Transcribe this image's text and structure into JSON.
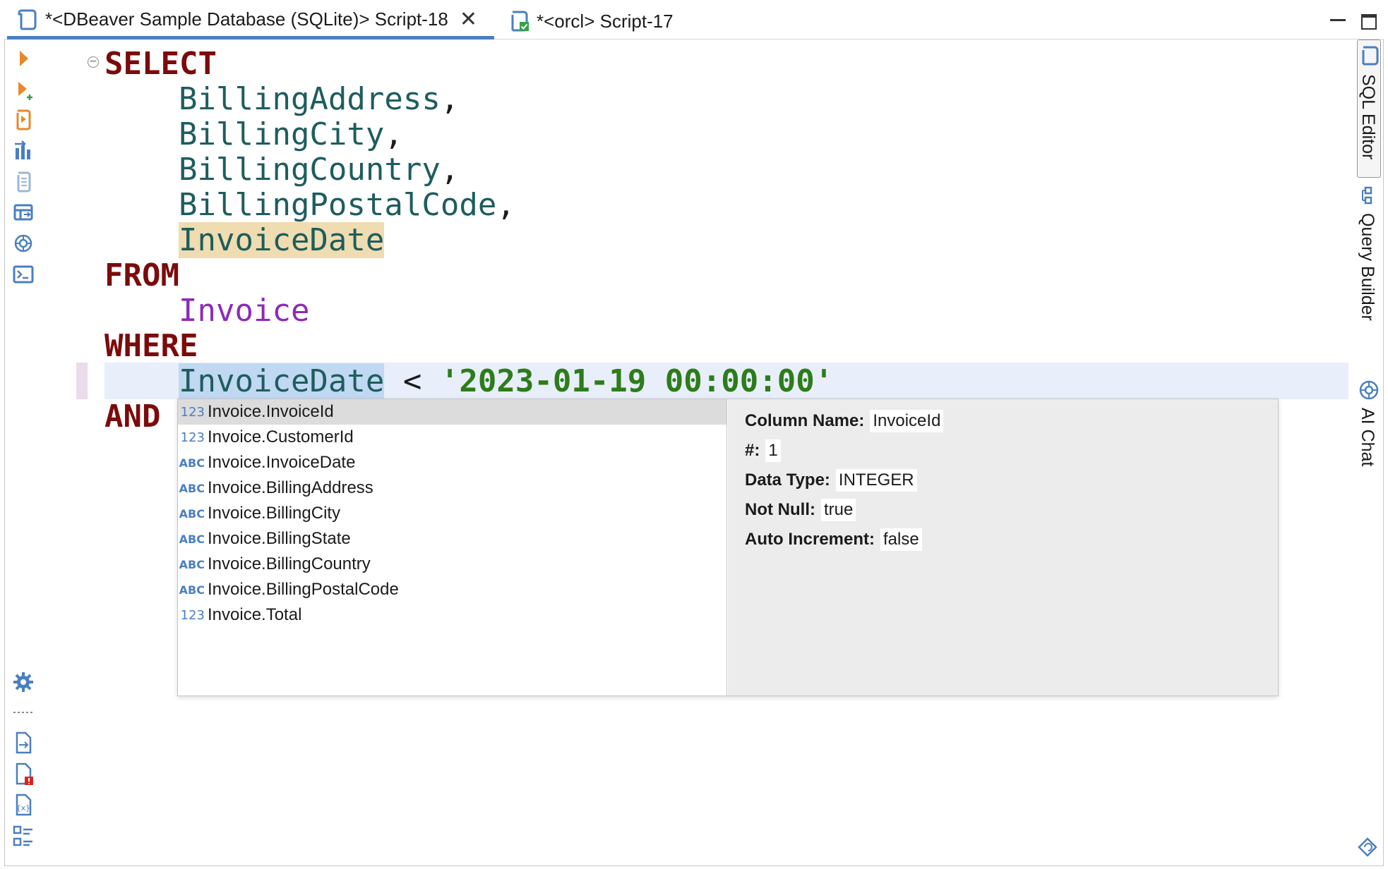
{
  "tabs": [
    {
      "label": "*<DBeaver Sample Database (SQLite)> Script-18",
      "icon": "sql-script-icon",
      "active": true,
      "closable": true
    },
    {
      "label": "*<orcl> Script-17",
      "icon": "sql-script-connected-icon",
      "active": false,
      "closable": false
    }
  ],
  "window_controls": {
    "minimize": "minimize-icon",
    "maximize": "maximize-icon"
  },
  "left_toolbar": {
    "top": [
      "execute-statement-icon",
      "execute-in-new-tab-icon",
      "execute-script-icon",
      "explain-plan-icon",
      "load-execution-plan-icon",
      "show-output-icon",
      "ai-assistant-icon",
      "open-terminal-icon"
    ],
    "bottom": [
      "settings-icon",
      "export-icon",
      "show-problems-icon",
      "variables-icon",
      "outline-icon"
    ]
  },
  "editor": {
    "lines": [
      {
        "indent": 0,
        "parts": [
          {
            "t": "SELECT",
            "c": "kw"
          }
        ]
      },
      {
        "indent": 1,
        "parts": [
          {
            "t": "BillingAddress",
            "c": "col"
          },
          {
            "t": ",",
            "c": "op"
          }
        ]
      },
      {
        "indent": 1,
        "parts": [
          {
            "t": "BillingCity",
            "c": "col"
          },
          {
            "t": ",",
            "c": "op"
          }
        ]
      },
      {
        "indent": 1,
        "parts": [
          {
            "t": "BillingCountry",
            "c": "col"
          },
          {
            "t": ",",
            "c": "op"
          }
        ]
      },
      {
        "indent": 1,
        "parts": [
          {
            "t": "BillingPostalCode",
            "c": "col"
          },
          {
            "t": ",",
            "c": "op"
          }
        ]
      },
      {
        "indent": 1,
        "parts": [
          {
            "t": "InvoiceDate",
            "c": "col hl-occ"
          }
        ]
      },
      {
        "indent": 0,
        "parts": [
          {
            "t": "FROM",
            "c": "kw"
          }
        ]
      },
      {
        "indent": 1,
        "parts": [
          {
            "t": "Invoice",
            "c": "tbl"
          }
        ]
      },
      {
        "indent": 0,
        "parts": [
          {
            "t": "WHERE",
            "c": "kw"
          }
        ]
      },
      {
        "indent": 1,
        "parts": [
          {
            "t": "InvoiceDate",
            "c": "col hl-sel"
          },
          {
            "t": " < ",
            "c": "op"
          },
          {
            "t": "'2023-01-19 00:00:00'",
            "c": "str"
          }
        ]
      },
      {
        "indent": 0,
        "parts": [
          {
            "t": "AND",
            "c": "kw"
          }
        ]
      }
    ]
  },
  "autocomplete": {
    "items": [
      {
        "type": "123",
        "label": "Invoice.InvoiceId",
        "selected": true
      },
      {
        "type": "123",
        "label": "Invoice.CustomerId"
      },
      {
        "type": "ABC",
        "label": "Invoice.InvoiceDate"
      },
      {
        "type": "ABC",
        "label": "Invoice.BillingAddress"
      },
      {
        "type": "ABC",
        "label": "Invoice.BillingCity"
      },
      {
        "type": "ABC",
        "label": "Invoice.BillingState"
      },
      {
        "type": "ABC",
        "label": "Invoice.BillingCountry"
      },
      {
        "type": "ABC",
        "label": "Invoice.BillingPostalCode"
      },
      {
        "type": "123",
        "label": "Invoice.Total"
      }
    ],
    "details": [
      {
        "label": "Column Name:",
        "value": "InvoiceId"
      },
      {
        "label": "#:",
        "value": "1"
      },
      {
        "label": "Data Type:",
        "value": "INTEGER"
      },
      {
        "label": "Not Null:",
        "value": "true"
      },
      {
        "label": "Auto Increment:",
        "value": "false"
      }
    ]
  },
  "right_panel": {
    "tabs": [
      {
        "label": "SQL Editor",
        "icon": "sql-editor-icon",
        "active": true
      },
      {
        "label": "Query Builder",
        "icon": "query-builder-icon"
      },
      {
        "label": "AI Chat",
        "icon": "ai-chat-icon"
      }
    ],
    "bottom_icon": "restore-icon"
  },
  "colors": {
    "keyword": "#7b0b0b",
    "column": "#1e5d5d",
    "table": "#8d2bb8",
    "string": "#2d7c1a",
    "accent": "#4a7fc1",
    "orange_action": "#e8892a"
  }
}
